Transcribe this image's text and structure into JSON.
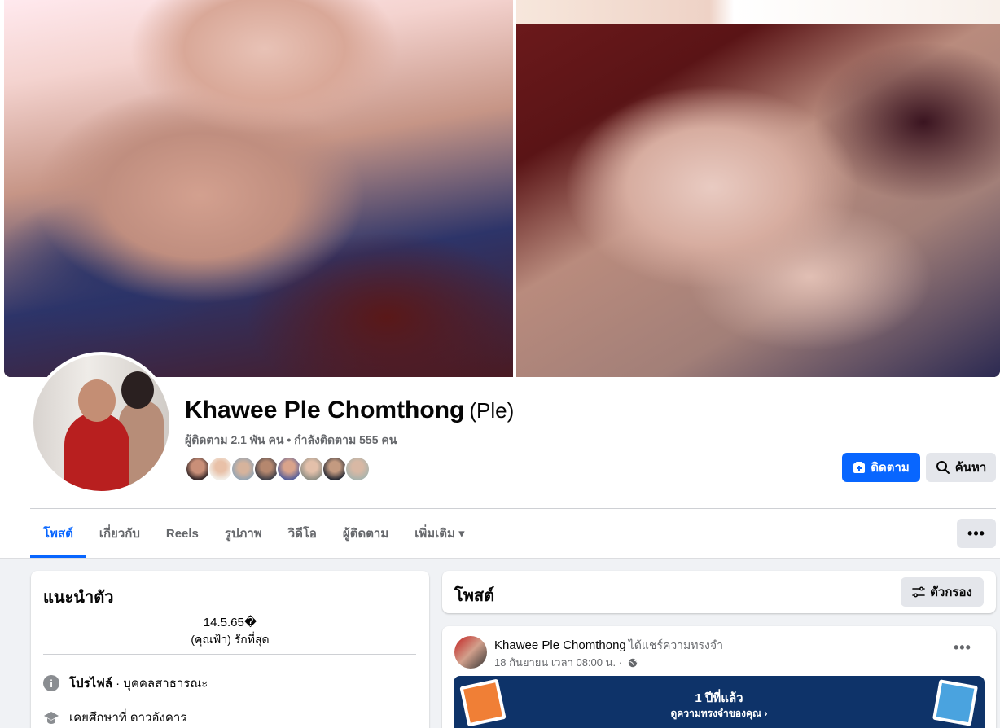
{
  "profile": {
    "name": "Khawee Ple Chomthong",
    "alt_name": "(Ple)",
    "stats": "ผู้ติดตาม 2.1 พัน คน • กำลังติดตาม 555 คน"
  },
  "actions": {
    "follow_label": "ติดตาม",
    "search_label": "ค้นหา",
    "more_label": "•••"
  },
  "tabs": [
    {
      "label": "โพสต์"
    },
    {
      "label": "เกี่ยวกับ"
    },
    {
      "label": "Reels"
    },
    {
      "label": "รูปภาพ"
    },
    {
      "label": "วิดีโอ"
    },
    {
      "label": "ผู้ติดตาม"
    },
    {
      "label": "เพิ่มเติม ▾"
    }
  ],
  "intro": {
    "title": "แนะนำตัว",
    "bio_line1": "14.5.65�",
    "bio_line2": "(คุณฟ้า) รักที่สุด",
    "profile_label": "โปรไฟล์",
    "profile_type": " · บุคคลสาธารณะ",
    "education": "เคยศึกษาที่ ดาวอังคาร"
  },
  "posts": {
    "title": "โพสต์",
    "filter_label": "ตัวกรอง"
  },
  "post": {
    "author": "Khawee Ple Chomthong",
    "action": "ได้แชร์ความทรงจำ",
    "time": "18 กันยายน เวลา 08:00 น. ·",
    "memory_title": "1 ปีที่แล้ว",
    "memory_link": "ดูความทรงจำของคุณ ›"
  },
  "colors": {
    "accent": "#0866ff",
    "memory_bg": "#0e3369"
  }
}
